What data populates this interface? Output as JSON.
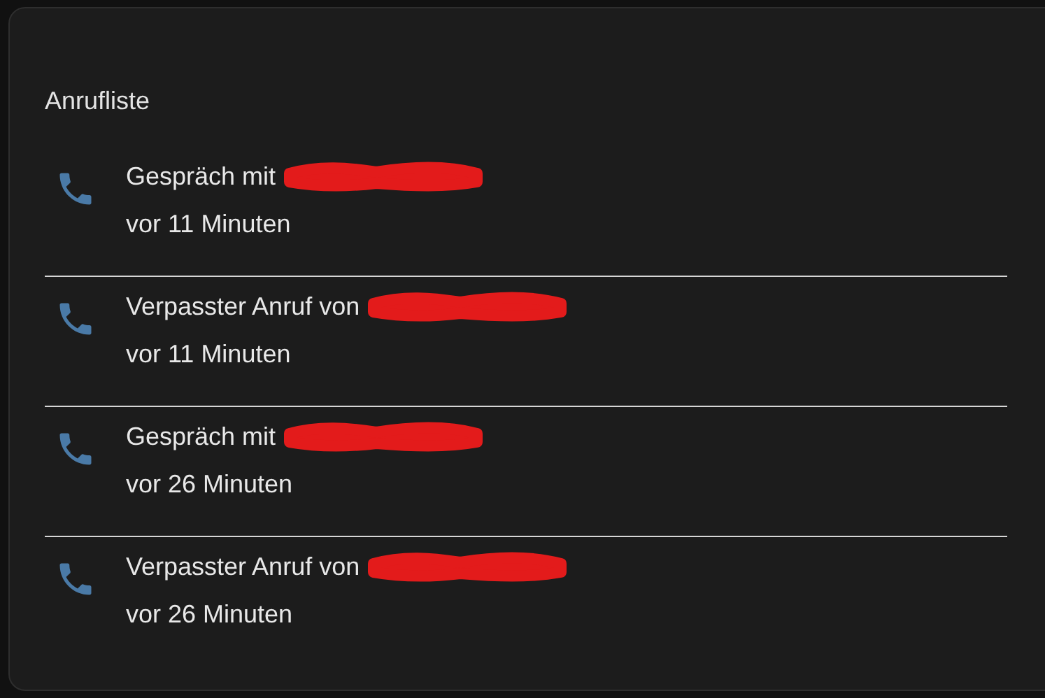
{
  "card": {
    "title": "Anrufliste"
  },
  "calls": [
    {
      "text": "Gespräch mit",
      "time": "vor 11 Minuten"
    },
    {
      "text": "Verpasster Anruf von",
      "time": "vor 11 Minuten"
    },
    {
      "text": "Gespräch mit",
      "time": "vor 26 Minuten"
    },
    {
      "text": "Verpasster Anruf von",
      "time": "vor 26 Minuten"
    }
  ]
}
